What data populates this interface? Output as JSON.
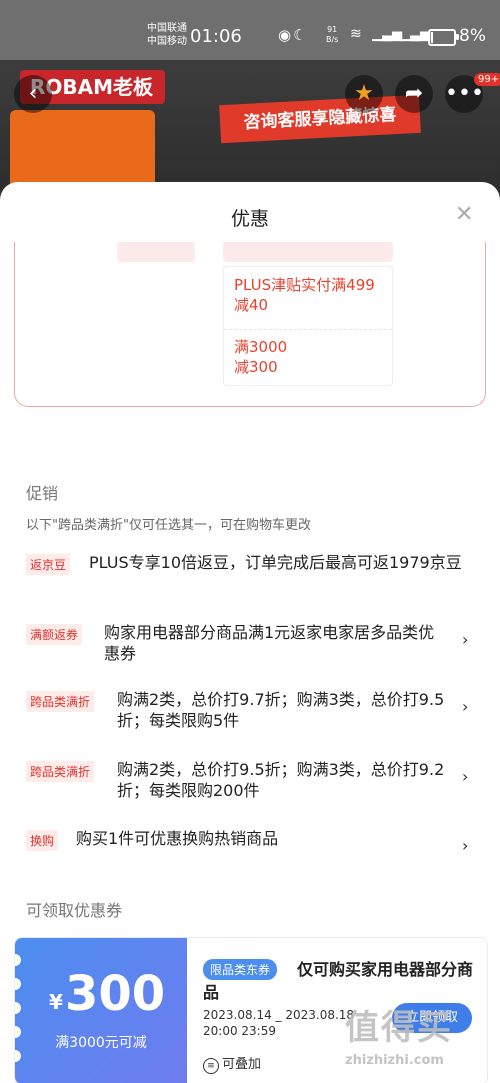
{
  "status_bar": {
    "carrier_1": "中国联通",
    "carrier_2": "中国移动",
    "time": "01:06",
    "speed_value": "91",
    "speed_unit": "B/s",
    "battery_percent": "8%",
    "battery_level": 0.08
  },
  "background": {
    "brand": "ROBAM老板",
    "banner_text": "咨询客服享隐藏惊喜",
    "more_badge": "99+"
  },
  "sheet": {
    "title": "优惠"
  },
  "offers": [
    {
      "text_line1": "PLUS津贴实付满499",
      "text_line2": "减40"
    },
    {
      "text_line1": "满3000",
      "text_line2": "减300"
    }
  ],
  "promotions": {
    "title": "促销",
    "note": "以下\"跨品类满折\"仅可任选其一，可在购物车更改",
    "items": [
      {
        "tag": "返京豆",
        "text": "PLUS专享10倍返豆，订单完成后最高可返1979京豆"
      },
      {
        "tag": "满额返券",
        "text": "购家用电器部分商品满1元返家电家居多品类优惠券"
      },
      {
        "tag": "跨品类满折",
        "text": "购满2类，总价打9.7折；购满3类，总价打9.5折；每类限购5件"
      },
      {
        "tag": "跨品类满折",
        "text": "购满2类，总价打9.5折；购满3类，总价打9.2折；每类限购200件"
      },
      {
        "tag": "换购",
        "text": "购买1件可优惠换购热销商品"
      }
    ]
  },
  "coupons": {
    "title": "可领取优惠券",
    "card": {
      "currency": "¥",
      "amount": "300",
      "condition": "满3000元可减",
      "category_tag": "限品类东券",
      "description": "仅可购买家用电器部分商品",
      "date_range": "2023.08.14 _ 2023.08.18",
      "time_range": "20:00 23:59",
      "stackable": "可叠加",
      "claim_label": "立即领取"
    }
  },
  "watermark": {
    "logo": "值得买",
    "url": "zhizhizhi.com"
  },
  "colors": {
    "accent_red": "#e3322c",
    "coupon_blue": "#4c8df0"
  }
}
